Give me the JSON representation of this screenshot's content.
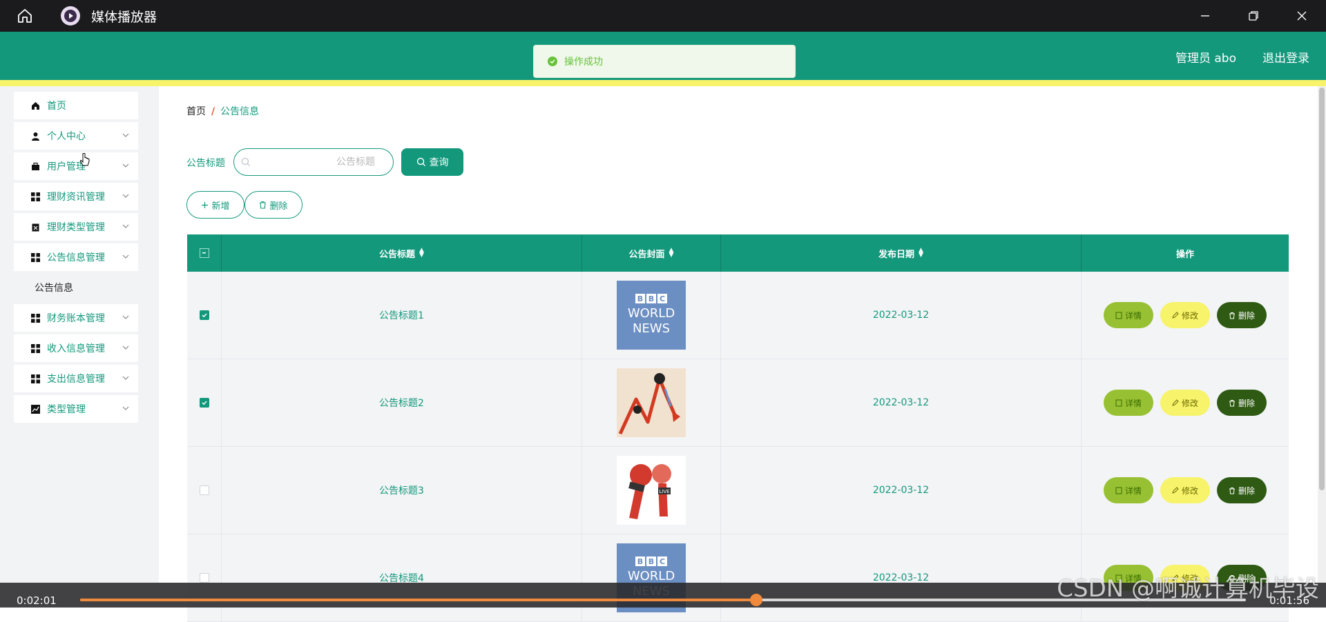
{
  "player": {
    "title": "媒体播放器",
    "time_elapsed": "0:02:01",
    "time_remaining": "0:01:56",
    "progress": 0.58,
    "watermark": "CSDN @啊诚计算机毕设",
    "accent_color": "#f08a3c"
  },
  "header": {
    "user": "管理员 abo",
    "logout": "退出登录",
    "toast": "操作成功",
    "brand_color": "#13987c",
    "stripe_color": "#f7f36a"
  },
  "sidebar": {
    "items": [
      {
        "label": "首页",
        "icon": "home-icon"
      },
      {
        "label": "个人中心",
        "icon": "user-icon"
      },
      {
        "label": "用户管理",
        "icon": "briefcase-icon"
      },
      {
        "label": "理财资讯管理",
        "icon": "grid-icon"
      },
      {
        "label": "理财类型管理",
        "icon": "clipboard-icon"
      },
      {
        "label": "公告信息管理",
        "icon": "grid-icon"
      },
      {
        "label": "公告信息",
        "icon": ""
      },
      {
        "label": "财务账本管理",
        "icon": "grid-icon"
      },
      {
        "label": "收入信息管理",
        "icon": "grid-icon"
      },
      {
        "label": "支出信息管理",
        "icon": "grid-icon"
      },
      {
        "label": "类型管理",
        "icon": "chart-icon"
      }
    ]
  },
  "breadcrumb": {
    "home": "首页",
    "sep": "/",
    "current": "公告信息"
  },
  "search": {
    "label": "公告标题",
    "placeholder": "公告标题",
    "button": "查询"
  },
  "actions": {
    "add": "新增",
    "delete": "删除"
  },
  "table": {
    "columns": [
      "公告标题",
      "公告封面",
      "发布日期",
      "操作"
    ],
    "rows": [
      {
        "title": "公告标题1",
        "cover": "bbc-world-news",
        "date": "2022-03-12",
        "checked": true
      },
      {
        "title": "公告标题2",
        "cover": "market-chart",
        "date": "2022-03-12",
        "checked": true
      },
      {
        "title": "公告标题3",
        "cover": "news-microphones",
        "date": "2022-03-12",
        "checked": false
      },
      {
        "title": "公告标题4",
        "cover": "bbc-world-news",
        "date": "2022-03-12",
        "checked": false
      }
    ],
    "row_buttons": {
      "detail": "详情",
      "edit": "修改",
      "delete": "删除"
    },
    "bbc_text": {
      "logo": [
        "B",
        "B",
        "C"
      ],
      "line1": "WORLD",
      "line2": "NEWS"
    },
    "live_badge": "LIVE"
  }
}
